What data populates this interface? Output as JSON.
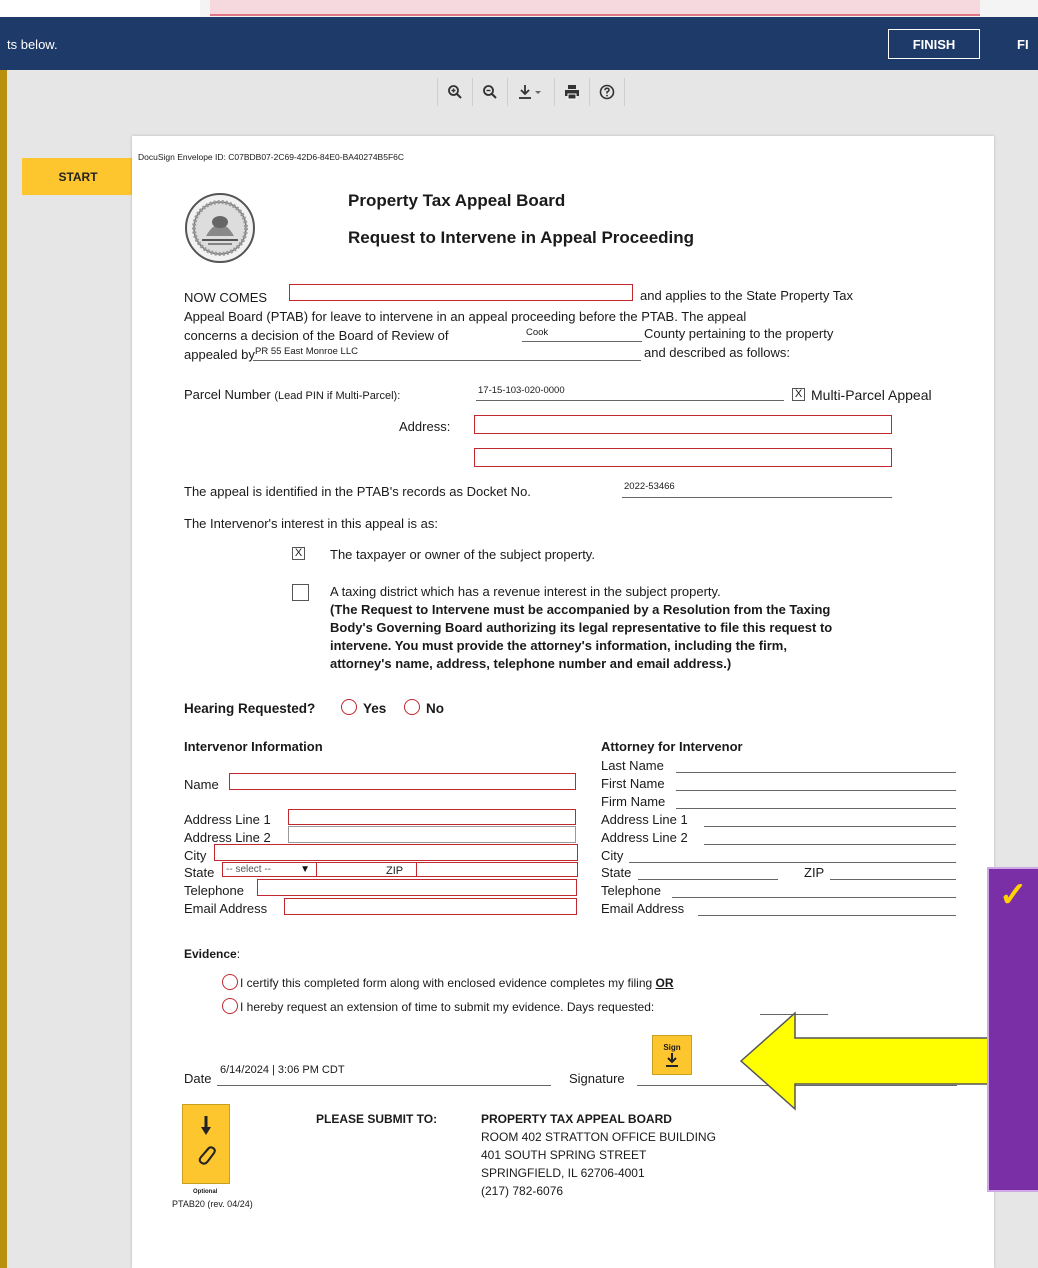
{
  "header": {
    "message": "ts below.",
    "finish_label": "FINISH",
    "finish_label_2": "FI"
  },
  "toolbar": {
    "zoom_in_icon": "zoom-in-icon",
    "zoom_out_icon": "zoom-out-icon",
    "download_icon": "download-icon",
    "print_icon": "print-icon",
    "help_icon": "help-icon"
  },
  "start_label": "START",
  "doc": {
    "envelope_id": "DocuSign Envelope ID: C07BDB07-2C69-42D6-84E0-BA40274B5F6C",
    "title": "Property Tax Appeal Board",
    "subtitle": "Request to Intervene in Appeal Proceeding",
    "para1_a": "NOW COMES",
    "para1_b": "and applies to the State Property Tax",
    "para1_line2": "Appeal Board (PTAB) for leave to intervene in an appeal proceeding before the PTAB. The appeal",
    "para1_line3_a": "concerns a decision of the Board of Review of",
    "para1_line3_b": "County pertaining to the property",
    "para1_line4_a": "appealed by",
    "para1_line4_b": "and described as follows:",
    "county_value": "Cook",
    "appellant_value": "PR 55 East Monroe LLC",
    "parcel_label": "Parcel Number",
    "parcel_note": "(Lead PIN if Multi-Parcel):",
    "parcel_value": "17-15-103-020-0000",
    "multi_parcel_label": "Multi-Parcel Appeal",
    "multi_parcel_mark": "X",
    "address_label": "Address:",
    "docket_label": "The appeal is identified in the PTAB's records as Docket No.",
    "docket_value": "2022-53466",
    "interest_label": "The Intervenor's interest in this appeal is as:",
    "opt1_mark": "X",
    "opt1_text": "The taxpayer or owner of the subject property.",
    "opt2_text": "A taxing district which has a revenue interest in the subject property.",
    "opt2_bold_1": "(The Request to Intervene must be accompanied by a Resolution from the Taxing",
    "opt2_bold_2": "Body's Governing Board authorizing its legal representative to file this request to",
    "opt2_bold_3": "intervene.  You must provide the attorney's information, including the firm,",
    "opt2_bold_4": "attorney's name, address, telephone number and email address.)",
    "hearing_label": "Hearing Requested?",
    "hearing_yes": "Yes",
    "hearing_no": "No",
    "intervenor_heading": "Intervenor Information",
    "attorney_heading": "Attorney for Intervenor",
    "int_name": "Name",
    "int_addr1": "Address Line 1",
    "int_addr2": "Address Line 2",
    "int_city": "City",
    "int_state": "State",
    "int_state_select": "-- select --",
    "int_zip": "ZIP",
    "int_phone": "Telephone",
    "int_email": "Email Address",
    "att_last": "Last Name",
    "att_first": "First Name",
    "att_firm": "Firm Name",
    "att_addr1": "Address Line 1",
    "att_addr2": "Address Line 2",
    "att_city": "City",
    "att_state": "State",
    "att_zip": "ZIP",
    "att_phone": "Telephone",
    "att_email": "Email Address",
    "evidence_label": "Evidence",
    "evidence_colon": ":",
    "ev1_text": "I certify this completed form along with enclosed evidence completes my filing",
    "ev1_or": "OR",
    "ev2_text": "I hereby request an extension of time to submit my evidence. Days requested:",
    "date_label": "Date",
    "date_value": "6/14/2024 | 3:06 PM CDT",
    "signature_label": "Signature",
    "sign_tab_label": "Sign",
    "submit_label": "PLEASE SUBMIT TO:",
    "submit_lines": [
      "PROPERTY TAX APPEAL BOARD",
      "ROOM 402 STRATTON OFFICE BUILDING",
      "401 SOUTH SPRING STREET",
      "SPRINGFIELD, IL 62706-4001",
      "(217) 782-6076"
    ],
    "attach_optional": "Optional",
    "form_id": "PTAB20 (rev. 04/24)"
  },
  "callout": {
    "check": "✓"
  },
  "colors": {
    "header": "#1e3a68",
    "tab": "#fdc52e",
    "field_border": "#c1272d",
    "arrow": "#ffff00",
    "callout": "#7a2fa6"
  }
}
